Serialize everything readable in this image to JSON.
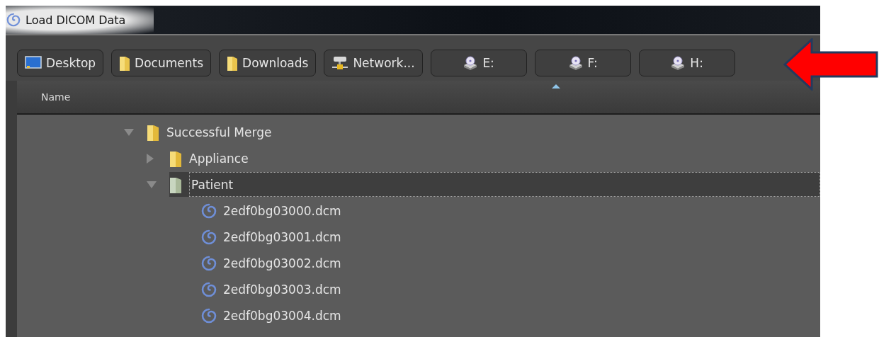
{
  "window": {
    "title": "Load DICOM Data"
  },
  "places": [
    {
      "label": "Desktop",
      "kind": "desktop"
    },
    {
      "label": "Documents",
      "kind": "folder"
    },
    {
      "label": "Downloads",
      "kind": "folder"
    },
    {
      "label": "Network...",
      "kind": "network"
    },
    {
      "label": "E:",
      "kind": "drive"
    },
    {
      "label": "F:",
      "kind": "drive"
    },
    {
      "label": "H:",
      "kind": "drive"
    }
  ],
  "table": {
    "columns": [
      {
        "label": "Name",
        "sorted": true
      }
    ]
  },
  "tree": [
    {
      "name": "Successful Merge",
      "kind": "folder",
      "expanded": true,
      "selected": false,
      "children": [
        {
          "name": "Appliance",
          "kind": "folder",
          "expanded": false,
          "selected": false
        },
        {
          "name": "Patient",
          "kind": "folder",
          "expanded": true,
          "selected": true,
          "children": [
            {
              "name": "2edf0bg03000.dcm",
              "kind": "file",
              "selected": false
            },
            {
              "name": "2edf0bg03001.dcm",
              "kind": "file",
              "selected": false
            },
            {
              "name": "2edf0bg03002.dcm",
              "kind": "file",
              "selected": false
            },
            {
              "name": "2edf0bg03003.dcm",
              "kind": "file",
              "selected": false
            },
            {
              "name": "2edf0bg03004.dcm",
              "kind": "file",
              "selected": false
            }
          ]
        }
      ]
    }
  ]
}
